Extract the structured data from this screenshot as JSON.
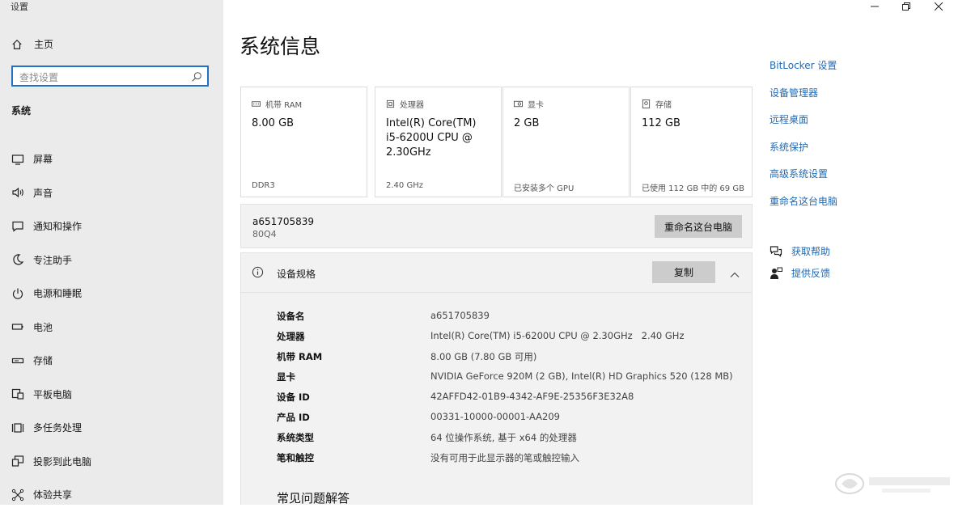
{
  "window": {
    "title": "设置"
  },
  "sidebar": {
    "home_label": "主页",
    "search_placeholder": "查找设置",
    "section_heading": "系统",
    "items": [
      {
        "label": "屏幕",
        "icon": "monitor-icon"
      },
      {
        "label": "声音",
        "icon": "speaker-icon"
      },
      {
        "label": "通知和操作",
        "icon": "notification-icon"
      },
      {
        "label": "专注助手",
        "icon": "moon-icon"
      },
      {
        "label": "电源和睡眠",
        "icon": "power-icon"
      },
      {
        "label": "电池",
        "icon": "battery-icon"
      },
      {
        "label": "存储",
        "icon": "storage-icon"
      },
      {
        "label": "平板电脑",
        "icon": "tablet-icon"
      },
      {
        "label": "多任务处理",
        "icon": "multitask-icon"
      },
      {
        "label": "投影到此电脑",
        "icon": "project-icon"
      },
      {
        "label": "体验共享",
        "icon": "share-icon"
      }
    ]
  },
  "main": {
    "title": "系统信息",
    "cards": [
      {
        "label": "机带 RAM",
        "value": "8.00 GB",
        "sub": "DDR3",
        "icon": "ram-icon"
      },
      {
        "label": "处理器",
        "value": "Intel(R) Core(TM) i5-6200U CPU @ 2.30GHz",
        "sub": "2.40 GHz",
        "icon": "cpu-icon"
      },
      {
        "label": "显卡",
        "value": "2 GB",
        "sub": "已安装多个 GPU",
        "icon": "gpu-icon"
      },
      {
        "label": "存储",
        "value": "112 GB",
        "sub": "已使用 112 GB 中的 69 GB",
        "icon": "disk-icon"
      }
    ],
    "device": {
      "name": "a651705839",
      "model": "80Q4",
      "rename_button": "重命名这台电脑"
    },
    "spec": {
      "title": "设备规格",
      "copy_button": "复制",
      "rows": [
        {
          "key": "设备名",
          "value": "a651705839"
        },
        {
          "key": "处理器",
          "value": "Intel(R) Core(TM) i5-6200U CPU @ 2.30GHz   2.40 GHz"
        },
        {
          "key": "机带 RAM",
          "value": "8.00 GB (7.80 GB 可用)"
        },
        {
          "key": "显卡",
          "value": "NVIDIA GeForce 920M (2 GB), Intel(R) HD Graphics 520 (128 MB)"
        },
        {
          "key": "设备 ID",
          "value": "42AFFD42-01B9-4342-AF9E-25356F3E32A8"
        },
        {
          "key": "产品 ID",
          "value": "00331-10000-00001-AA209"
        },
        {
          "key": "系统类型",
          "value": "64 位操作系统, 基于 x64 的处理器"
        },
        {
          "key": "笔和触控",
          "value": "没有可用于此显示器的笔或触控输入"
        }
      ],
      "faq_heading": "常见问题解答"
    }
  },
  "related": {
    "links": [
      "BitLocker 设置",
      "设备管理器",
      "远程桌面",
      "系统保护",
      "高级系统设置",
      "重命名这台电脑"
    ],
    "help": [
      {
        "label": "获取帮助",
        "icon": "chat-help-icon"
      },
      {
        "label": "提供反馈",
        "icon": "feedback-icon"
      }
    ]
  },
  "colors": {
    "accent": "#1f6ab5",
    "sidebar_bg": "#ebebeb",
    "panel_bg": "#f2f2f2",
    "button_bg": "#cccccc"
  }
}
